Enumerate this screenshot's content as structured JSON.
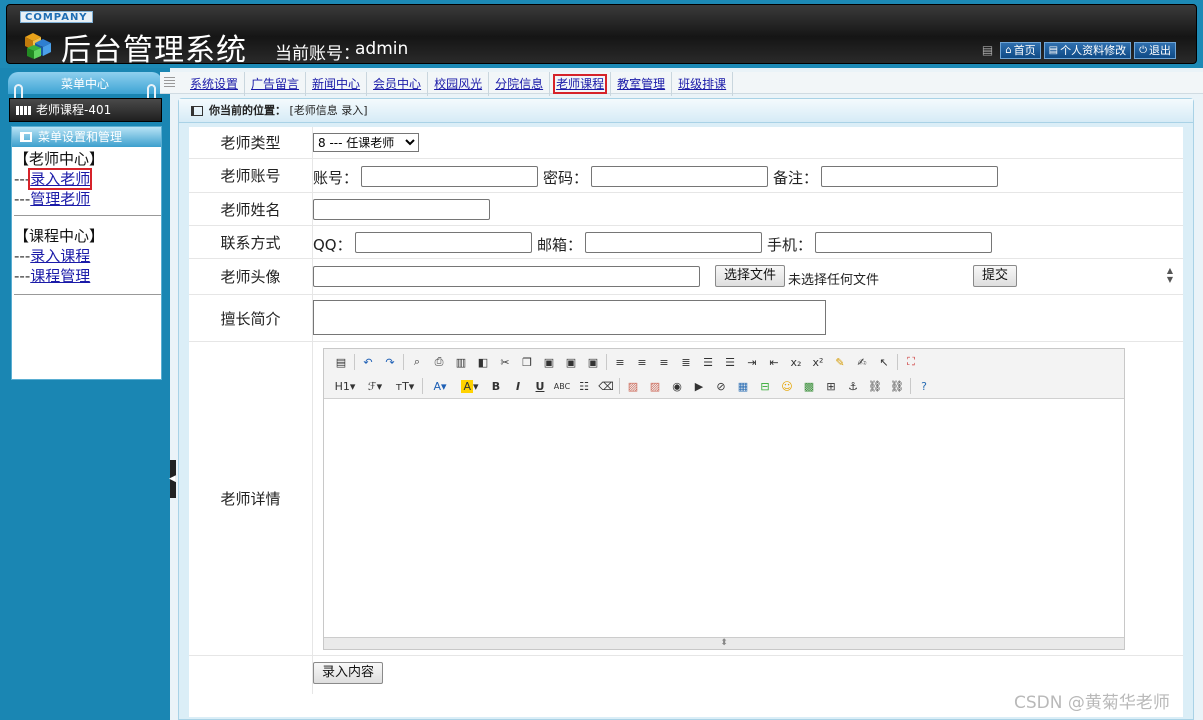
{
  "header": {
    "company": "COMPANY",
    "title": "后台管理系统",
    "account_label": "当前账号：",
    "account_name": "admin",
    "links": [
      "首页",
      "个人资料修改",
      "退出"
    ]
  },
  "sidebar": {
    "menu_center": "菜单中心",
    "current_item": "老师课程-401",
    "box_title": "菜单设置和管理",
    "groups": [
      {
        "title": "【老师中心】",
        "items": [
          "录入老师",
          "管理老师"
        ]
      },
      {
        "title": "【课程中心】",
        "items": [
          "录入课程",
          "课程管理"
        ]
      }
    ],
    "item_prefix": "---"
  },
  "topnav": {
    "items": [
      "系统设置",
      "广告留言",
      "新闻中心",
      "会员中心",
      "校园风光",
      "分院信息",
      "老师课程",
      "教室管理",
      "班级排课"
    ],
    "active_index": 6
  },
  "breadcrumb": {
    "label": "你当前的位置：",
    "value": "[老师信息 录入]"
  },
  "form": {
    "type_label": "老师类型",
    "type_value": "8 --- 任课老师",
    "account_row_label": "老师账号",
    "account_field": "账号：",
    "password_field": "密码：",
    "remark_field": "备注：",
    "name_label": "老师姓名",
    "contact_label": "联系方式",
    "qq_field": "QQ：",
    "email_field": "邮箱：",
    "phone_field": "手机：",
    "avatar_label": "老师头像",
    "choose_file": "选择文件",
    "no_file": "未选择任何文件",
    "upload": "提交",
    "intro_label": "擅长简介",
    "detail_label": "老师详情",
    "submit": "录入内容"
  },
  "editor": {
    "toolbar_row2_text": [
      "H1",
      "ℱ",
      "тT",
      "A",
      "A",
      "B",
      "I",
      "U",
      "ABC"
    ]
  },
  "watermark": "CSDN @黄菊华老师",
  "colors": {
    "accent": "#1a86b3",
    "highlight": "#d6232a",
    "link": "#1a1aa8"
  }
}
